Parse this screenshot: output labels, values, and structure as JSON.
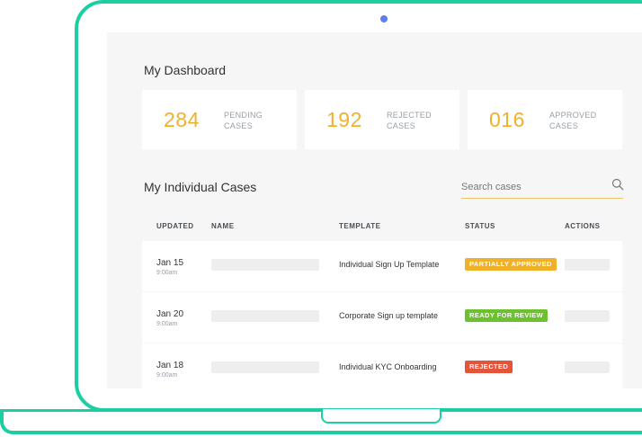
{
  "dashboard": {
    "title": "My Dashboard"
  },
  "stats": [
    {
      "value": "284",
      "label_line1": "PENDING",
      "label_line2": "CASES"
    },
    {
      "value": "192",
      "label_line1": "REJECTED",
      "label_line2": "CASES"
    },
    {
      "value": "016",
      "label_line1": "APPROVED",
      "label_line2": "CASES"
    }
  ],
  "cases": {
    "title": "My Individual Cases",
    "search_placeholder": "Search cases",
    "columns": [
      "UPDATED",
      "NAME",
      "TEMPLATE",
      "STATUS",
      "ACTIONS"
    ],
    "rows": [
      {
        "date": "Jan 15",
        "time": "9:00am",
        "template": "Individual Sign Up Template",
        "status": "PARTIALLY APPROVED",
        "status_color": "#f0b12a"
      },
      {
        "date": "Jan 20",
        "time": "9:00am",
        "template": "Corporate Sign up template",
        "status": "READY FOR REVIEW",
        "status_color": "#6dc12e"
      },
      {
        "date": "Jan 18",
        "time": "9:00am",
        "template": "Individual KYC Onboarding",
        "status": "REJECTED",
        "status_color": "#e4533a"
      }
    ]
  },
  "colors": {
    "frame": "#1ccfa3",
    "camera": "#5f7cf0",
    "accent": "#f0b12a"
  },
  "icons": {
    "search": "search-icon",
    "camera": "camera-dot"
  }
}
